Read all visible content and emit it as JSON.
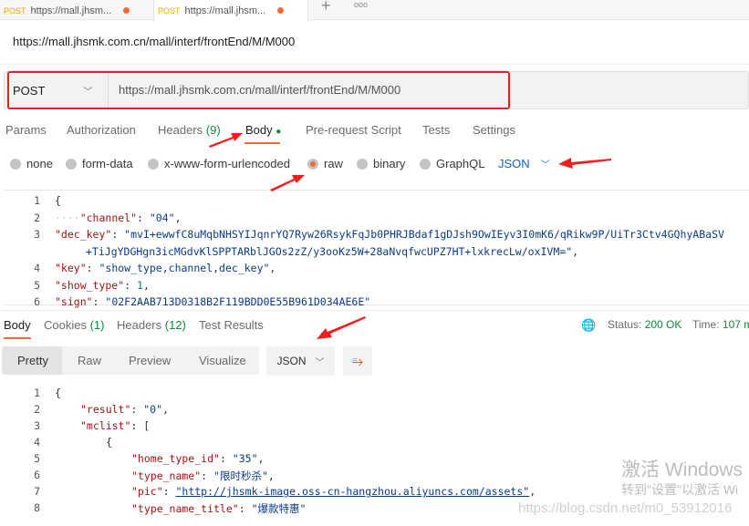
{
  "tabs": [
    {
      "method": "POST",
      "label": "https://mall.jhsm..."
    },
    {
      "method": "POST",
      "label": "https://mall.jhsm..."
    }
  ],
  "tab_add": "+",
  "tab_more": "ooo",
  "title": "https://mall.jhsmk.com.cn/mall/interf/frontEnd/M/M000",
  "request": {
    "method": "POST",
    "url": "https://mall.jhsmk.com.cn/mall/interf/frontEnd/M/M000"
  },
  "req_tabs": {
    "params": "Params",
    "authorization": "Authorization",
    "headers": "Headers",
    "headers_count": "(9)",
    "body": "Body",
    "prerequest": "Pre-request Script",
    "tests": "Tests",
    "settings": "Settings"
  },
  "body_types": [
    "none",
    "form-data",
    "x-www-form-urlencoded",
    "raw",
    "binary",
    "GraphQL"
  ],
  "body_selected": "raw",
  "body_format": "JSON",
  "req_body_lines": [
    {
      "n": "1",
      "t": "{"
    },
    {
      "n": "2",
      "k": "\"channel\"",
      "v": "\"04\"",
      "e": ",",
      "indent": "····"
    },
    {
      "n": "3",
      "k": "\"dec_key\"",
      "v": "\"mvI+ewwfC8uMqbNHSYIJqnrYQ7Ryw26RsykFqJb0PHRJBdaf1gDJsh9OwIEyv3I0mK6/qRikw9P/UiTr3Ctv4GQhyABaSV"
    },
    {
      "n": "",
      "v": "+TiJgYDGHgn3icMGdvKlSPPTARblJGOs2zZ/y3ooKz5W+28aNvqfwcUPZ7HT+lxkrecLw/oxIVM=\"",
      "e": ","
    },
    {
      "n": "4",
      "k": "\"key\"",
      "v": "\"show_type,channel,dec_key\"",
      "e": ","
    },
    {
      "n": "5",
      "k": "\"show_type\"",
      "num": "1",
      "e": ","
    },
    {
      "n": "6",
      "k": "\"sign\"",
      "v": "\"02F2AAB713D0318B2F119BDD0E55B961D034AE6E\""
    }
  ],
  "resp_tabs": {
    "body": "Body",
    "cookies": "Cookies",
    "cookies_count": "(1)",
    "headers": "Headers",
    "headers_count": "(12)",
    "tests": "Test Results"
  },
  "status": {
    "label": "Status:",
    "value": "200 OK",
    "time_label": "Time:",
    "time_value": "107 m"
  },
  "views": [
    "Pretty",
    "Raw",
    "Preview",
    "Visualize"
  ],
  "resp_format": "JSON",
  "resp_lines": [
    {
      "n": "1",
      "t": "{",
      "i": 0
    },
    {
      "n": "2",
      "k": "\"result\"",
      "v": "\"0\"",
      "e": ",",
      "i": 1
    },
    {
      "n": "3",
      "k": "\"mclist\"",
      "t": ": [",
      "i": 1
    },
    {
      "n": "4",
      "t": "{",
      "i": 2
    },
    {
      "n": "5",
      "k": "\"home_type_id\"",
      "v": "\"35\"",
      "e": ",",
      "i": 3
    },
    {
      "n": "6",
      "k": "\"type_name\"",
      "v": "\"限时秒杀\"",
      "e": ",",
      "i": 3
    },
    {
      "n": "7",
      "k": "\"pic\"",
      "v": "\"http://jhsmk-image.oss-cn-hangzhou.aliyuncs.com/assets\"",
      "e": ",",
      "i": 3
    },
    {
      "n": "8",
      "k": "\"type_name_title\"",
      "v": "\"爆款特惠\"",
      "i": 3
    }
  ],
  "watermark": {
    "line1": "激活 Windows",
    "line2": "转到\"设置\"以激活 Wi",
    "url": "https://blog.csdn.net/m0_53912016"
  },
  "colors": {
    "accent": "#f26b3a",
    "annotation": "#f21d1d",
    "status_ok": "#0f8a3b"
  }
}
